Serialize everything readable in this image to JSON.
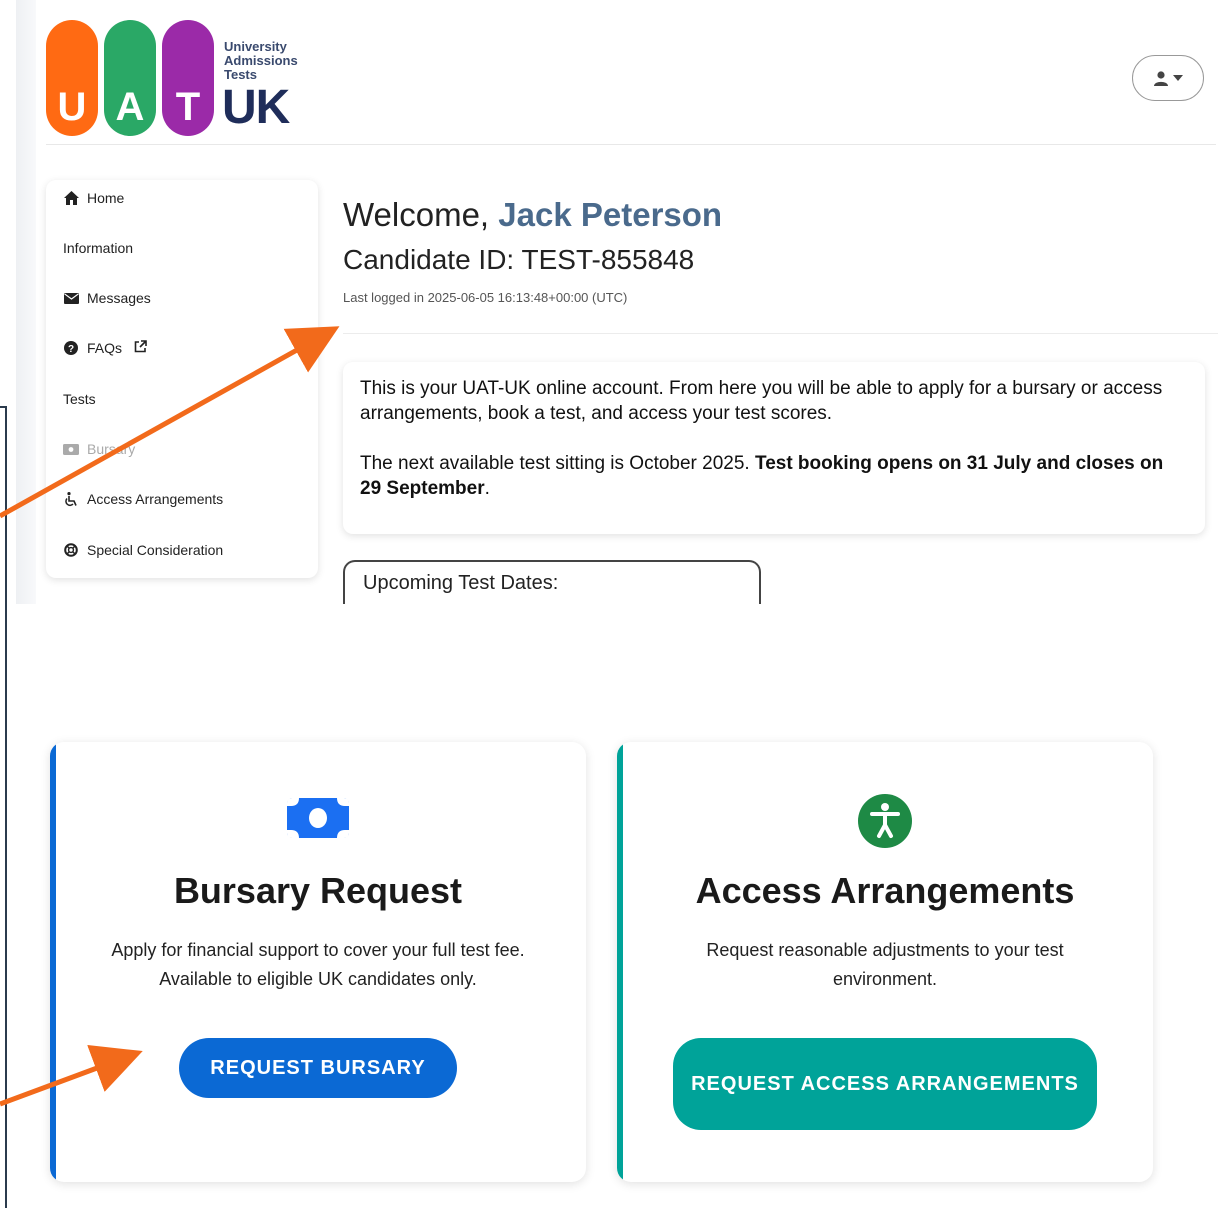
{
  "header": {
    "logo": {
      "letters": [
        "U",
        "A",
        "T"
      ],
      "letter_colors": [
        "#ff6a13",
        "#2aa866",
        "#9b2aa8"
      ],
      "small_text": [
        "University",
        "Admissions",
        "Tests"
      ],
      "big_text": "UK"
    },
    "user_menu_icon": "user-icon",
    "user_menu_caret": "caret-down-icon"
  },
  "sidebar": {
    "items": [
      {
        "label": "Home",
        "icon": "home-icon",
        "glyph": "⌂"
      },
      {
        "label": "Information",
        "icon": "",
        "glyph": ""
      },
      {
        "label": "Messages",
        "icon": "envelope-icon",
        "glyph": "✉"
      },
      {
        "label": "FAQs",
        "icon": "question-circle-icon",
        "glyph": "?"
      },
      {
        "label": "Tests",
        "icon": "",
        "glyph": ""
      },
      {
        "label": "Bursary",
        "icon": "money-bill-icon",
        "glyph": "▣"
      },
      {
        "label": "Access Arrangements",
        "icon": "wheelchair-icon",
        "glyph": "♿"
      },
      {
        "label": "Special Consideration",
        "icon": "life-ring-icon",
        "glyph": "⊛"
      }
    ]
  },
  "main": {
    "welcome_prefix": "Welcome, ",
    "user_name": "Jack Peterson",
    "candidate_id": "Candidate ID: TEST-855848",
    "last_logged": "Last logged in 2025-06-05 16:13:48+00:00 (UTC)",
    "info_p1": "This is your UAT-UK online account. From here you will be able to apply for a bursary or access arrangements, book a test, and access your test scores.",
    "info_p2_normal": "The next available test sitting is October 2025. ",
    "info_p2_bold": "Test booking opens on 31 July and closes on 29 September",
    "info_p2_end": ".",
    "upcoming_title": "Upcoming Test Dates:"
  },
  "cards": {
    "bursary": {
      "title": "Bursary Request",
      "description": "Apply for financial support to cover your full test fee. Available to eligible UK candidates only.",
      "button": "REQUEST BURSARY",
      "accent_color": "#0b69d4",
      "icon": "money-bill-icon"
    },
    "access": {
      "title": "Access Arrangements",
      "description": "Request reasonable adjustments to your test environment.",
      "button": "REQUEST ACCESS ARRANGEMENTS",
      "accent_color": "#00a399",
      "icon": "accessibility-icon"
    }
  },
  "annotations": {
    "arrow_color": "#f26a1b"
  }
}
